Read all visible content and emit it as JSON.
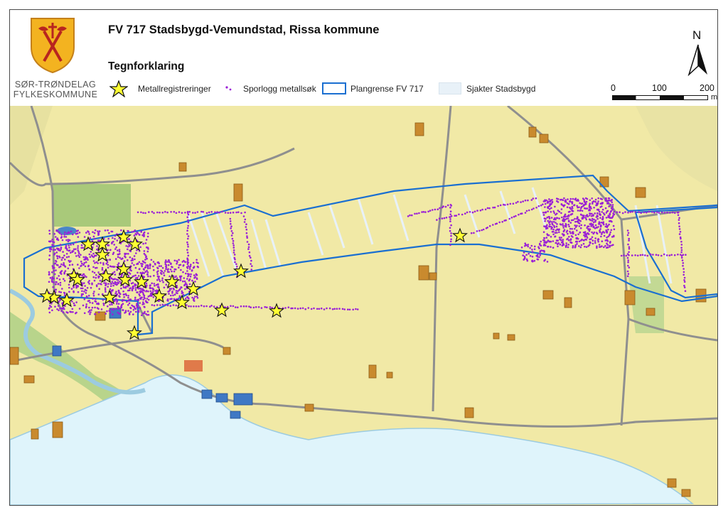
{
  "header": {
    "title": "FV 717 Stadsbygd-Vemundstad, Rissa kommune",
    "legend_title": "Tegnforklaring",
    "organization_line1": "SØR-TRØNDELAG",
    "organization_line2": "FYLKESKOMMUNE"
  },
  "legend": {
    "items": [
      {
        "label": "Metallregistreringer",
        "symbol": "yellow-star"
      },
      {
        "label": "Sporlogg metallsøk",
        "symbol": "purple-dots"
      },
      {
        "label": "Plangrense FV 717",
        "symbol": "blue-outline"
      },
      {
        "label": "Sjakter Stadsbygd",
        "symbol": "light-fill"
      }
    ]
  },
  "north_arrow": {
    "label": "N"
  },
  "scale_bar": {
    "labels": [
      "0",
      "100",
      "200"
    ],
    "unit": "m"
  },
  "colors": {
    "plan_boundary": "#1a6fd1",
    "track_log": "#9a1fd6",
    "star_fill": "#ffff33",
    "water": "#dff4fb",
    "farmland": "#f1e9a6",
    "building": "#c98a2e"
  }
}
